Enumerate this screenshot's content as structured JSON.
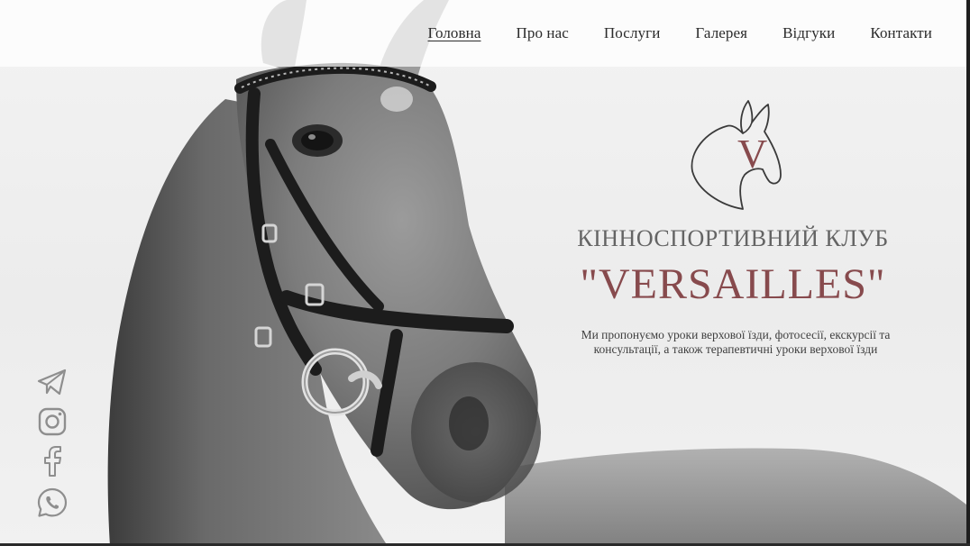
{
  "nav": {
    "items": [
      {
        "label": "Головна",
        "active": true
      },
      {
        "label": "Про нас",
        "active": false
      },
      {
        "label": "Послуги",
        "active": false
      },
      {
        "label": "Галерея",
        "active": false
      },
      {
        "label": "Відгуки",
        "active": false
      },
      {
        "label": "Контакти",
        "active": false
      }
    ]
  },
  "hero": {
    "title": "КІННОСПОРТИВНИЙ КЛУБ",
    "brand": "\"VERSAILLES\"",
    "description": "Ми пропонуємо уроки верхової їзди, фотосесії, екскурсії та консультації, а також терапевтичні уроки верхової їзди",
    "logo_letter": "V"
  },
  "social": [
    {
      "icon": "telegram-icon"
    },
    {
      "icon": "instagram-icon"
    },
    {
      "icon": "facebook-icon"
    },
    {
      "icon": "whatsapp-icon"
    }
  ],
  "colors": {
    "accent": "#874a4d",
    "title_gray": "#646464",
    "icon_gray": "#8e8e8e",
    "nav_text": "#2b2b2b"
  }
}
